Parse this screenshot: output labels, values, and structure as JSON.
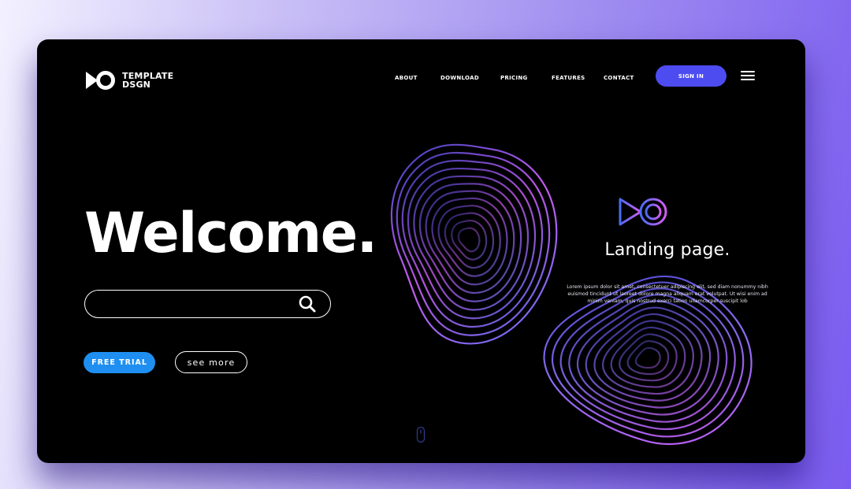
{
  "brand": {
    "logo_icon": "play-circle-logo-icon",
    "name_line1": "TEMPLATE",
    "name_line2": "DSGN"
  },
  "nav": {
    "items": [
      {
        "label": "ABOUT"
      },
      {
        "label": "DOWNLOAD"
      },
      {
        "label": "PRICING"
      },
      {
        "label": "FEATURES"
      },
      {
        "label": "CONTACT"
      }
    ],
    "signin_label": "SIGN IN",
    "menu_icon": "hamburger-menu-icon"
  },
  "hero": {
    "headline": "Welcome.",
    "search": {
      "placeholder": "",
      "value": "",
      "icon": "search-icon"
    },
    "free_trial_label": "FREE TRIAL",
    "see_more_label": "see more"
  },
  "feature": {
    "icon": "play-circle-logo-icon",
    "title": "Landing page.",
    "body": "Lorem ipsum dolor sit amet, consectetuer adipiscing elit, sed diam nonummy nibh euismod tincidunt ut laoreet dolore magna aliquam erat volutpat. Ut wisi enim ad minim veniam, quis nostrud exerci tation ullamcorper suscipit lob"
  },
  "scroll_indicator": {
    "icon": "mouse-scroll-icon"
  },
  "colors": {
    "background": "#000000",
    "accent_signin": "#4d4cf0",
    "accent_free_trial": "#1e8ff0",
    "contour_purple": "#c75cf0",
    "contour_blue": "#5f6cf0",
    "text": "#ffffff"
  }
}
